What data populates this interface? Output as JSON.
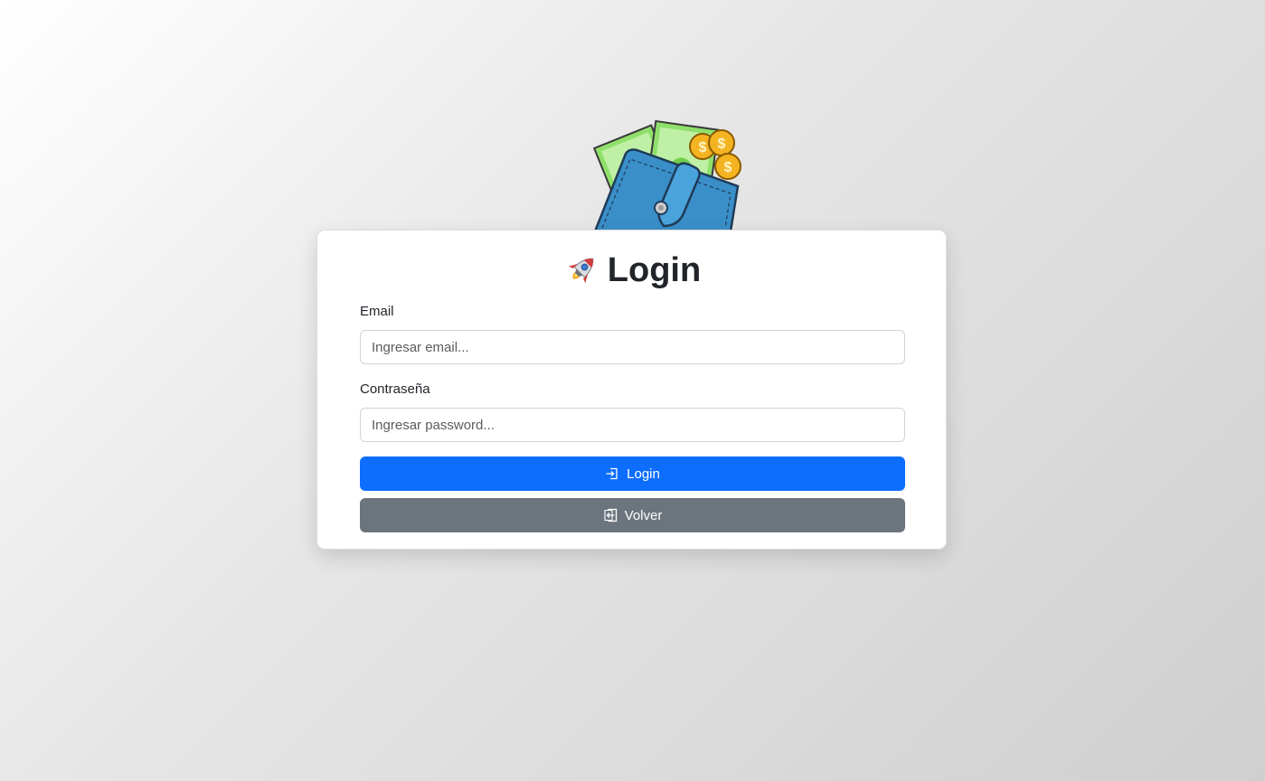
{
  "login": {
    "title": "Login",
    "email_label": "Email",
    "email_placeholder": "Ingresar email...",
    "password_label": "Contraseña",
    "password_placeholder": "Ingresar password...",
    "login_button_label": "Login",
    "back_button_label": "Volver"
  },
  "icons": {
    "title": "rocket-icon",
    "login_button": "box-arrow-in-right-icon",
    "back_button": "box-arrow-left-icon",
    "illustration": "wallet-with-money-illustration"
  },
  "colors": {
    "primary": "#0d6efd",
    "secondary": "#6c757d"
  }
}
